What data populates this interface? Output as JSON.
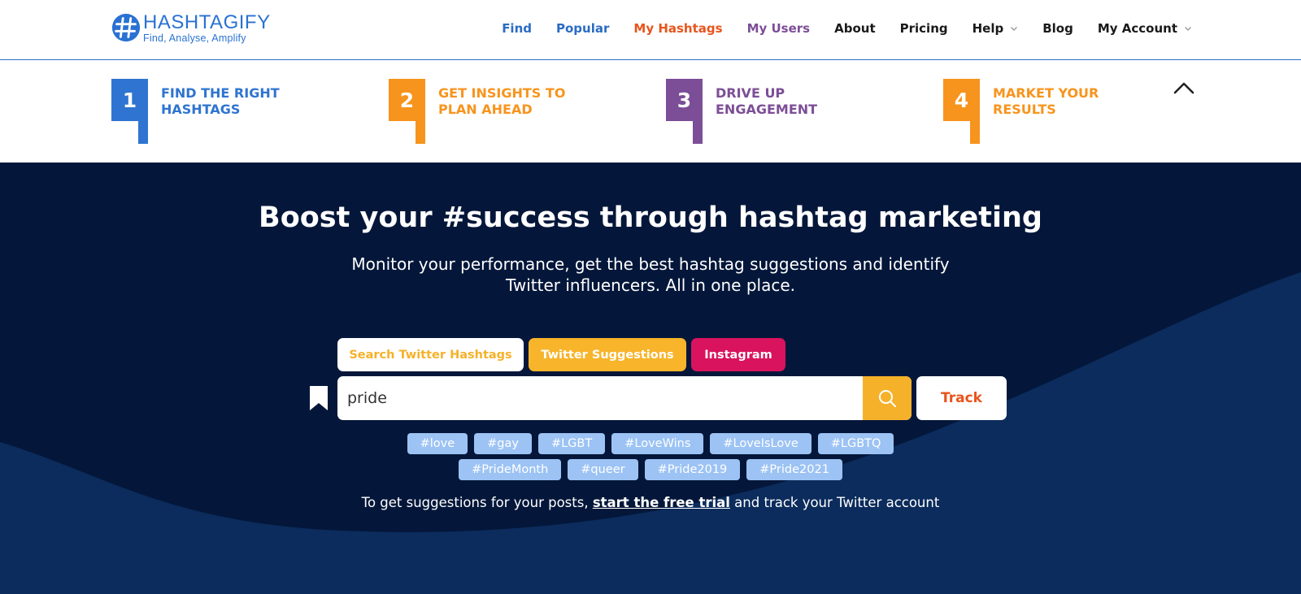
{
  "brand": {
    "name": "HASHTAGIFY",
    "tagline": "Find, Analyse, Amplify",
    "color": "#2a72d2"
  },
  "nav": {
    "items": [
      {
        "label": "Find",
        "color": "blue"
      },
      {
        "label": "Popular",
        "color": "blue"
      },
      {
        "label": "My Hashtags",
        "color": "orange"
      },
      {
        "label": "My Users",
        "color": "purple"
      },
      {
        "label": "About",
        "color": "dark"
      },
      {
        "label": "Pricing",
        "color": "dark"
      },
      {
        "label": "Help",
        "color": "dark",
        "dropdown": true
      },
      {
        "label": "Blog",
        "color": "dark"
      },
      {
        "label": "My Account",
        "color": "dark",
        "dropdown": true
      }
    ]
  },
  "steps": [
    {
      "number": "1",
      "label": "FIND THE RIGHT HASHTAGS",
      "color": "#2f74d0"
    },
    {
      "number": "2",
      "label": "GET INSIGHTS TO PLAN AHEAD",
      "color": "#f7941d"
    },
    {
      "number": "3",
      "label": "DRIVE UP ENGAGEMENT",
      "color": "#7c4e97"
    },
    {
      "number": "4",
      "label": "MARKET YOUR RESULTS",
      "color": "#f7941d"
    }
  ],
  "hero": {
    "title": "Boost your #success through hashtag marketing",
    "subtitle": "Monitor your performance, get the best hashtag suggestions and identify Twitter influencers. All in one place."
  },
  "search": {
    "tabs": [
      {
        "label": "Search Twitter Hashtags"
      },
      {
        "label": "Twitter Suggestions"
      },
      {
        "label": "Instagram"
      }
    ],
    "value": "pride",
    "track_label": "Track"
  },
  "suggestions": {
    "row1": [
      "#love",
      "#gay",
      "#LGBT",
      "#LoveWins",
      "#LoveIsLove",
      "#LGBTQ"
    ],
    "row2": [
      "#PrideMonth",
      "#queer",
      "#Pride2019",
      "#Pride2021"
    ]
  },
  "footer_line": {
    "before": "To get suggestions for your posts, ",
    "link": "start the free trial",
    "after": " and track your Twitter account"
  },
  "colors": {
    "hero_bg": "#04173a",
    "wave": "#0b2c5c",
    "accent_yellow": "#f6b12a",
    "accent_pink": "#d9135e",
    "accent_orange": "#e8541c",
    "tag_bg": "#9cc3f4"
  }
}
